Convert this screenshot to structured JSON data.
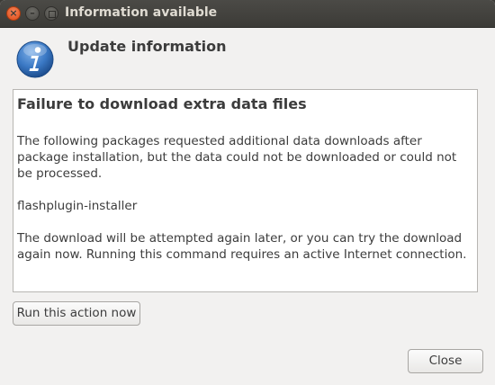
{
  "window": {
    "title": "Information available",
    "controls": [
      "close",
      "minimize",
      "maximize"
    ]
  },
  "header": {
    "icon": "info-icon",
    "heading": "Update information"
  },
  "message": {
    "title": "Failure to download extra data files",
    "paragraph1": "The following packages requested additional data downloads after package installation, but the data could not be downloaded or could not be processed.",
    "package": "flashplugin-installer",
    "paragraph2": "The download will be attempted again later, or you can try the download again now.  Running this command requires an active Internet connection."
  },
  "actions": {
    "run_label": "Run this action now",
    "close_label": "Close"
  },
  "colors": {
    "titlebar": "#3c3b37",
    "close_button": "#df4a16",
    "window_bg": "#f2f1f0",
    "info_icon": "#2f6db5"
  }
}
